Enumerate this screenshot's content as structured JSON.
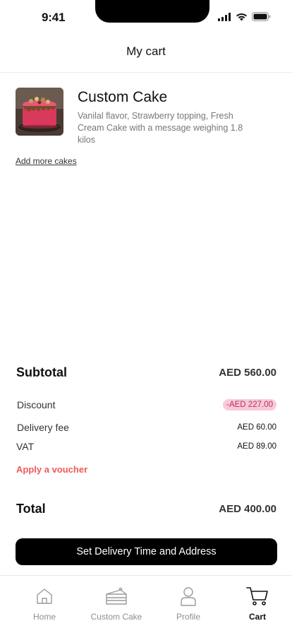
{
  "status_bar": {
    "time": "9:41"
  },
  "header": {
    "title": "My cart"
  },
  "cart_item": {
    "name": "Custom Cake",
    "description": "Vanilal flavor, Strawberry topping, Fresh Cream Cake with a message weighing 1.8 kilos"
  },
  "add_more_label": "Add more cakes",
  "summary": {
    "subtotal_label": "Subtotal",
    "subtotal_value": "AED 560.00",
    "discount_label": "Discount",
    "discount_value": "-AED 227.00",
    "delivery_label": "Delivery fee",
    "delivery_value": "AED 60.00",
    "vat_label": "VAT",
    "vat_value": "AED 89.00",
    "voucher_label": "Apply a voucher",
    "total_label": "Total",
    "total_value": "AED 400.00"
  },
  "cta_label": "Set Delivery Time and Address",
  "tabs": [
    {
      "label": "Home",
      "icon": "home-icon"
    },
    {
      "label": "Custom Cake",
      "icon": "cake-icon"
    },
    {
      "label": "Profile",
      "icon": "profile-icon"
    },
    {
      "label": "Cart",
      "icon": "cart-icon",
      "active": true
    }
  ],
  "colors": {
    "accent_voucher": "#ee5a5a",
    "discount_badge_bg": "#f9c9d9",
    "discount_badge_text": "#b8325c",
    "cta_bg": "#000000"
  }
}
